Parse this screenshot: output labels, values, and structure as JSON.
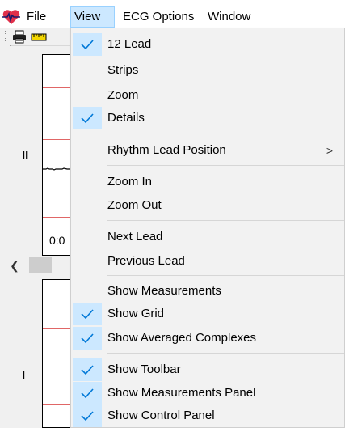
{
  "menubar": {
    "items": [
      {
        "label": "File"
      },
      {
        "label": "View"
      },
      {
        "label": "ECG Options"
      },
      {
        "label": "Window"
      }
    ]
  },
  "panels": {
    "top_lead": "II",
    "top_time": "0:0",
    "bottom_lead": "I"
  },
  "view_menu": {
    "items": [
      {
        "label": "12 Lead",
        "checked": true
      },
      {
        "label": "Strips",
        "checked": false
      },
      {
        "label": "Zoom",
        "checked": false
      },
      {
        "label": "Details",
        "checked": true
      },
      {
        "label": "Rhythm Lead Position",
        "checked": false,
        "submenu_arrow": ">"
      },
      {
        "label": "Zoom In",
        "checked": false
      },
      {
        "label": "Zoom Out",
        "checked": false
      },
      {
        "label": "Next Lead",
        "checked": false
      },
      {
        "label": "Previous Lead",
        "checked": false
      },
      {
        "label": "Show Measurements",
        "checked": false
      },
      {
        "label": "Show Grid",
        "checked": true
      },
      {
        "label": "Show Averaged Complexes",
        "checked": true
      },
      {
        "label": "Show Toolbar",
        "checked": true
      },
      {
        "label": "Show Measurements Panel",
        "checked": true
      },
      {
        "label": "Show Control Panel",
        "checked": true
      }
    ]
  },
  "colors": {
    "check_highlight": "#cce8ff",
    "check_mark": "#0078d7",
    "ecg_grid_line": "#e06666"
  }
}
